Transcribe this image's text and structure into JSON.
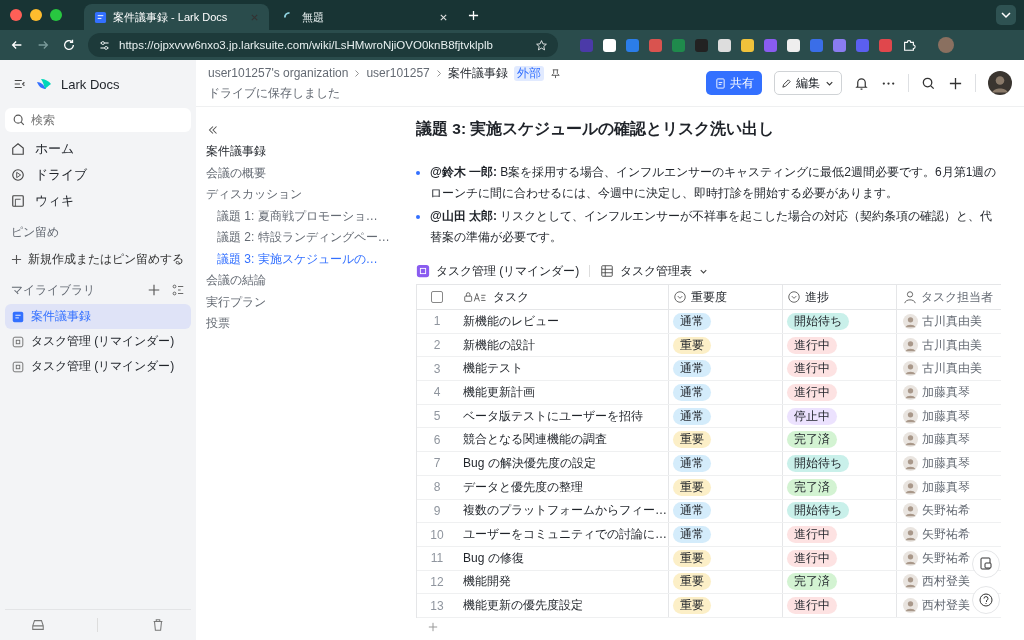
{
  "browser": {
    "tabs": [
      {
        "title": "案件議事録 - Lark Docs",
        "selected": true,
        "loading": false
      },
      {
        "title": "無題",
        "selected": false,
        "loading": true
      }
    ],
    "url": "https://ojpxvvw6nxo3.jp.larksuite.com/wiki/LsHMwroNjiOVO0knB8fjtvklplb"
  },
  "sidebar": {
    "app_name": "Lark Docs",
    "search": {
      "placeholder": "検索"
    },
    "nav": [
      {
        "label": "ホーム",
        "kind": "home"
      },
      {
        "label": "ドライブ",
        "kind": "drive"
      },
      {
        "label": "ウィキ",
        "kind": "wiki"
      }
    ],
    "pinned_heading": "ピン留め",
    "pin_action": "新規作成またはピン留めする",
    "library_heading": "マイライブラリ",
    "library": [
      {
        "label": "案件議事録",
        "kind": "doc",
        "selected": true
      },
      {
        "label": "タスク管理 (リマインダー)",
        "kind": "base",
        "selected": false
      },
      {
        "label": "タスク管理 (リマインダー)",
        "kind": "base",
        "selected": false
      }
    ]
  },
  "header": {
    "breadcrumbs": [
      "user101257's organization",
      "user101257",
      "案件議事録"
    ],
    "badge": "外部",
    "status": "ドライブに保存しました",
    "share_button": "共有",
    "edit_button": "編集"
  },
  "outline": [
    {
      "label": "案件議事録",
      "selected": false
    },
    {
      "label": "会議の概要",
      "selected": false
    },
    {
      "label": "ディスカッション",
      "selected": false,
      "children": [
        {
          "label": "議題 1: 夏商戦プロモーショ…",
          "selected": false
        },
        {
          "label": "議題 2: 特設ランディングペー…",
          "selected": false
        },
        {
          "label": "議題 3: 実施スケジュールの…",
          "selected": true
        }
      ]
    },
    {
      "label": "会議の結論",
      "selected": false
    },
    {
      "label": "実行プラン",
      "selected": false
    },
    {
      "label": "投票",
      "selected": false
    }
  ],
  "document": {
    "heading": "議題 3: 実施スケジュールの確認とリスク洗い出し",
    "bullets": [
      "**@鈴木 一郎:** B案を採用する場合、インフルエンサーのキャスティングに最低2週間必要です。6月第1週のローンチに間に合わせるには、今週中に決定し、即時打診を開始する必要があります。",
      "**@山田 太郎:** リスクとして、インフルエンサーが不祥事を起こした場合の対応（契約条項の確認）と、代替案の準備が必要です。"
    ],
    "table": {
      "source": "タスク管理 (リマインダー)",
      "view": "タスク管理表",
      "all_checked": false,
      "columns": [
        {
          "label": "タスク",
          "kind": "text"
        },
        {
          "label": "重要度",
          "kind": "select"
        },
        {
          "label": "進捗",
          "kind": "select"
        },
        {
          "label": "タスク担当者",
          "kind": "person"
        }
      ],
      "rows": [
        {
          "index": "1",
          "task": "新機能のレビュー",
          "importance": {
            "label": "通常",
            "color": "#d4ecfb"
          },
          "progress": {
            "label": "開始待ち",
            "color": "#c9f0ea"
          },
          "assignee": "古川真由美"
        },
        {
          "index": "2",
          "task": "新機能の設計",
          "importance": {
            "label": "重要",
            "color": "#fcefc7"
          },
          "progress": {
            "label": "進行中",
            "color": "#fde2e2"
          },
          "assignee": "古川真由美"
        },
        {
          "index": "3",
          "task": "機能テスト",
          "importance": {
            "label": "通常",
            "color": "#d4ecfb"
          },
          "progress": {
            "label": "進行中",
            "color": "#fde2e2"
          },
          "assignee": "古川真由美"
        },
        {
          "index": "4",
          "task": "機能更新計画",
          "importance": {
            "label": "通常",
            "color": "#d4ecfb"
          },
          "progress": {
            "label": "進行中",
            "color": "#fde2e2"
          },
          "assignee": "加藤真琴"
        },
        {
          "index": "5",
          "task": "ベータ版テストにユーザーを招待",
          "importance": {
            "label": "通常",
            "color": "#d4ecfb"
          },
          "progress": {
            "label": "停止中",
            "color": "#ece2fe"
          },
          "assignee": "加藤真琴"
        },
        {
          "index": "6",
          "task": "競合となる関連機能の調査",
          "importance": {
            "label": "重要",
            "color": "#fcefc7"
          },
          "progress": {
            "label": "完了済",
            "color": "#d3f3d2"
          },
          "assignee": "加藤真琴"
        },
        {
          "index": "7",
          "task": "Bug の解決優先度の設定",
          "importance": {
            "label": "通常",
            "color": "#d4ecfb"
          },
          "progress": {
            "label": "開始待ち",
            "color": "#c9f0ea"
          },
          "assignee": "加藤真琴"
        },
        {
          "index": "8",
          "task": "データと優先度の整理",
          "importance": {
            "label": "重要",
            "color": "#fcefc7"
          },
          "progress": {
            "label": "完了済",
            "color": "#d3f3d2"
          },
          "assignee": "加藤真琴"
        },
        {
          "index": "9",
          "task": "複数のプラットフォームからフィー…",
          "importance": {
            "label": "通常",
            "color": "#d4ecfb"
          },
          "progress": {
            "label": "開始待ち",
            "color": "#c9f0ea"
          },
          "assignee": "矢野祐希"
        },
        {
          "index": "10",
          "task": "ユーザーをコミュニティでの討論に…",
          "importance": {
            "label": "通常",
            "color": "#d4ecfb"
          },
          "progress": {
            "label": "進行中",
            "color": "#fde2e2"
          },
          "assignee": "矢野祐希"
        },
        {
          "index": "11",
          "task": "Bug の修復",
          "importance": {
            "label": "重要",
            "color": "#fcefc7"
          },
          "progress": {
            "label": "進行中",
            "color": "#fde2e2"
          },
          "assignee": "矢野祐希"
        },
        {
          "index": "12",
          "task": "機能開発",
          "importance": {
            "label": "重要",
            "color": "#fcefc7"
          },
          "progress": {
            "label": "完了済",
            "color": "#d3f3d2"
          },
          "assignee": "西村登美"
        },
        {
          "index": "13",
          "task": "機能更新の優先度設定",
          "importance": {
            "label": "重要",
            "color": "#fcefc7"
          },
          "progress": {
            "label": "進行中",
            "color": "#fde2e2"
          },
          "assignee": "西村登美"
        }
      ]
    }
  }
}
